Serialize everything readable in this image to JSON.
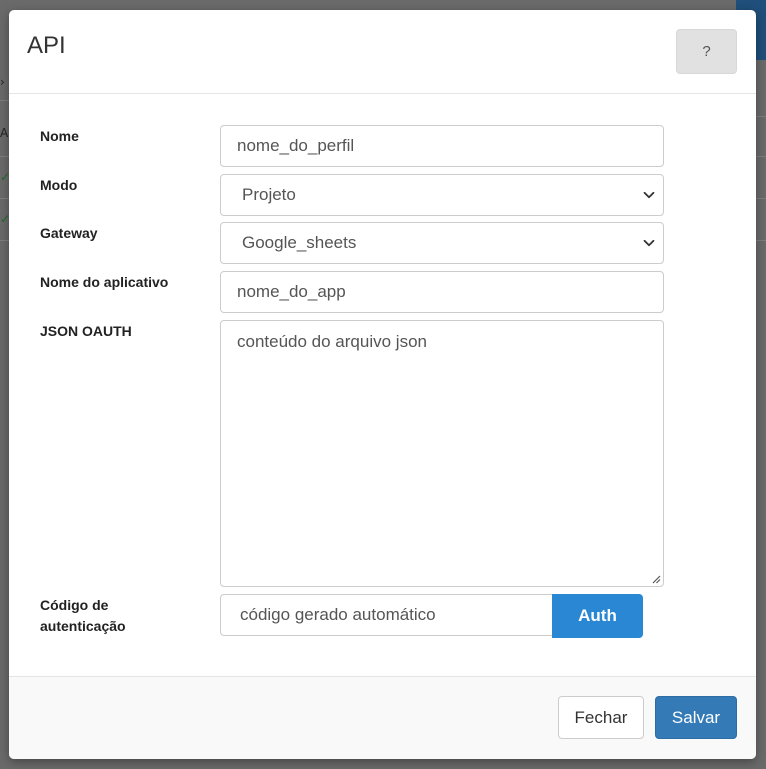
{
  "modal": {
    "title": "API",
    "help_label": "?"
  },
  "form": {
    "nome": {
      "label": "Nome",
      "value": "nome_do_perfil"
    },
    "modo": {
      "label": "Modo",
      "value": "Projeto"
    },
    "gateway": {
      "label": "Gateway",
      "value": "Google_sheets"
    },
    "nome_aplicativo": {
      "label": "Nome do aplicativo",
      "value": "nome_do_app"
    },
    "json_oauth": {
      "label": "JSON OAUTH",
      "value": "conteúdo do arquivo json"
    },
    "codigo_autenticacao": {
      "label_line1": "Código de",
      "label_line2": "autenticação",
      "value": "código gerado automático",
      "auth_label": "Auth"
    }
  },
  "footer": {
    "close_label": "Fechar",
    "save_label": "Salvar"
  },
  "background": {
    "glyph_a": "A",
    "glyph_arrow": "›",
    "check": "✓"
  },
  "colors": {
    "auth_button": "#2a87d4",
    "save_button": "#337ab7",
    "help_button": "#e1e1e1"
  }
}
